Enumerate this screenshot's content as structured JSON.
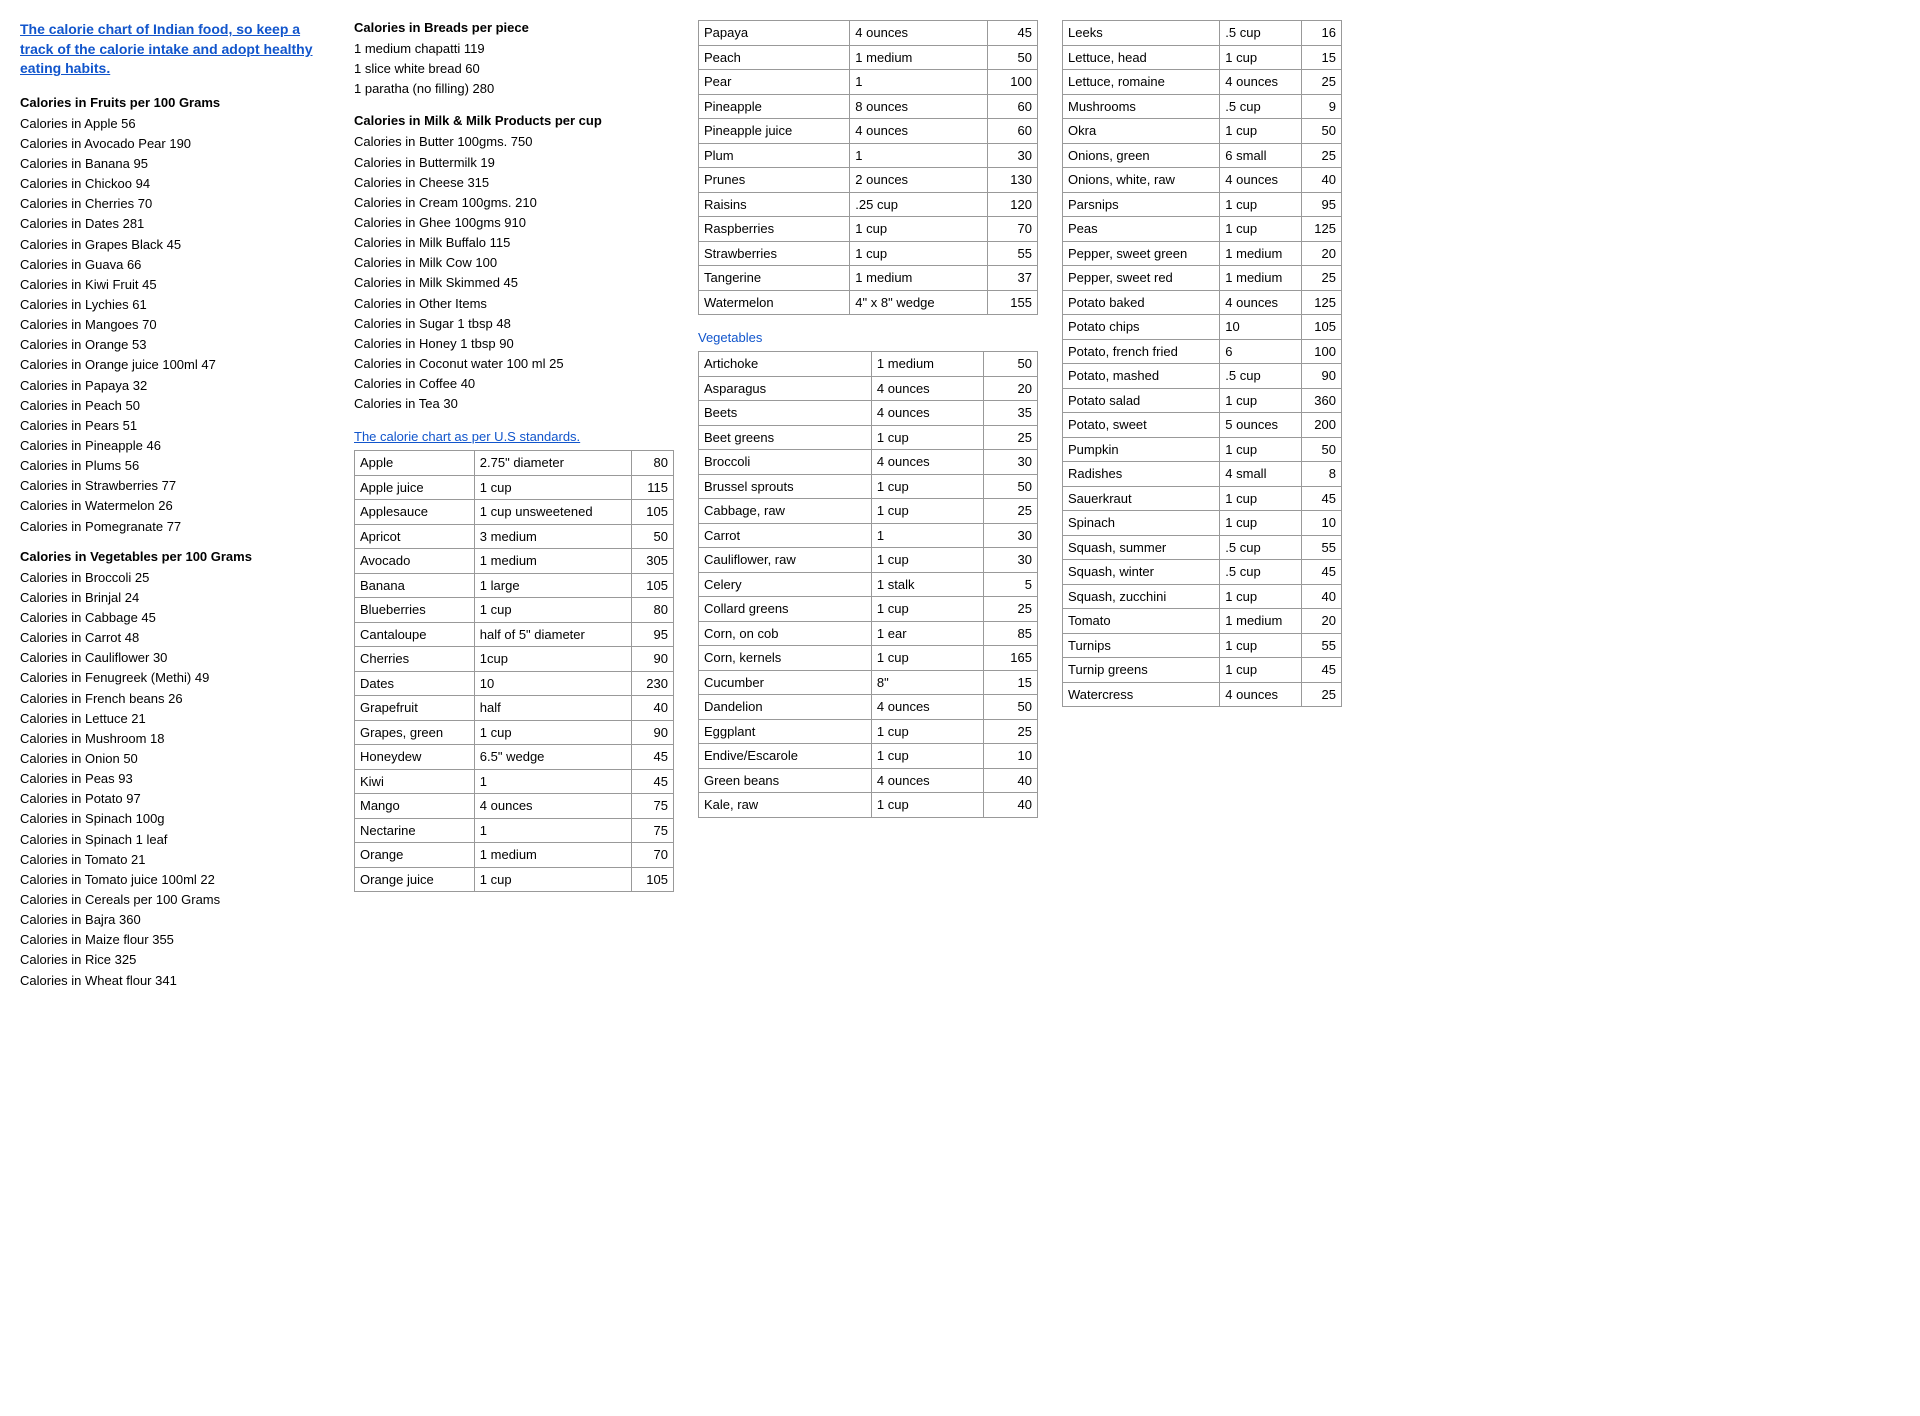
{
  "title": {
    "text": "The calorie chart of Indian food, so keep a track of the calorie intake and adopt healthy eating habits.",
    "link": true
  },
  "col1": {
    "fruits_section": {
      "title": "Calories in Fruits per 100 Grams",
      "items": [
        "Calories in Apple 56",
        "Calories in Avocado Pear 190",
        "Calories in Banana 95",
        "Calories in Chickoo 94",
        "Calories in Cherries 70",
        "Calories in Dates 281",
        "Calories in Grapes Black 45",
        "Calories in Guava 66",
        "Calories in Kiwi Fruit 45",
        "Calories in Lychies 61",
        "Calories in Mangoes 70",
        "Calories in Orange 53",
        "Calories in Orange juice 100ml 47",
        "Calories in Papaya 32",
        "Calories in Peach 50",
        "Calories in Pears 51",
        "Calories in Pineapple 46",
        "Calories in Plums 56",
        "Calories in Strawberries 77",
        "Calories in Watermelon 26",
        "Calories in Pomegranate 77"
      ]
    },
    "vegetables_section": {
      "title": "Calories in Vegetables per 100 Grams",
      "items": [
        "Calories in Broccoli 25",
        "Calories in Brinjal 24",
        "Calories in Cabbage 45",
        "Calories in Carrot 48",
        "Calories in Cauliflower 30",
        "Calories in Fenugreek (Methi) 49",
        "Calories in French beans 26",
        "Calories in Lettuce 21",
        "Calories in Mushroom 18",
        "Calories in Onion 50",
        "Calories in Peas 93",
        "Calories in Potato 97",
        "Calories in Spinach 100g",
        "Calories in Spinach 1 leaf",
        "Calories in Tomato 21",
        "Calories in Tomato juice 100ml 22",
        "Calories in Cereals per 100 Grams",
        "Calories in Bajra 360",
        "Calories in Maize flour 355",
        "Calories in Rice 325",
        "Calories in Wheat flour 341"
      ]
    }
  },
  "col2": {
    "breads_section": {
      "title": "Calories in Breads per piece",
      "items": [
        "1 medium chapatti 119",
        "1 slice white bread 60",
        "1 paratha (no filling) 280"
      ]
    },
    "milk_section": {
      "title": "Calories in Milk & Milk Products per cup",
      "items": [
        "Calories in Butter 100gms. 750",
        "Calories in Buttermilk 19",
        "Calories in Cheese 315",
        "Calories in Cream 100gms. 210",
        "Calories in Ghee 100gms 910",
        "Calories in Milk Buffalo 115",
        "Calories in Milk Cow 100",
        "Calories in Milk Skimmed 45",
        "Calories in Other Items",
        "Calories in Sugar 1 tbsp 48",
        "Calories in Honey 1 tbsp 90",
        "Calories in Coconut water 100 ml 25",
        "Calories in Coffee 40",
        "Calories in Tea 30"
      ]
    },
    "us_section": {
      "title": "The calorie chart as per U.S standards.",
      "fruits": [
        [
          "Apple",
          "2.75\" diameter",
          "80"
        ],
        [
          "Apple juice",
          "1 cup",
          "115"
        ],
        [
          "Applesauce",
          "1 cup unsweetened",
          "105"
        ],
        [
          "Apricot",
          "3 medium",
          "50"
        ],
        [
          "Avocado",
          "1 medium",
          "305"
        ],
        [
          "Banana",
          "1 large",
          "105"
        ],
        [
          "Blueberries",
          "1 cup",
          "80"
        ],
        [
          "Cantaloupe",
          "half of 5\" diameter",
          "95"
        ],
        [
          "Cherries",
          "1cup",
          "90"
        ],
        [
          "Dates",
          "10",
          "230"
        ],
        [
          "Grapefruit",
          "half",
          "40"
        ],
        [
          "Grapes, green",
          "1 cup",
          "90"
        ],
        [
          "Honeydew",
          "6.5\" wedge",
          "45"
        ],
        [
          "Kiwi",
          "1",
          "45"
        ],
        [
          "Mango",
          "4 ounces",
          "75"
        ],
        [
          "Nectarine",
          "1",
          "75"
        ],
        [
          "Orange",
          "1 medium",
          "70"
        ],
        [
          "Orange juice",
          "1 cup",
          "105"
        ]
      ]
    }
  },
  "col3": {
    "fruits_continued": [
      [
        "Papaya",
        "4 ounces",
        "45"
      ],
      [
        "Peach",
        "1 medium",
        "50"
      ],
      [
        "Pear",
        "1",
        "100"
      ],
      [
        "Pineapple",
        "8 ounces",
        "60"
      ],
      [
        "Pineapple juice",
        "4 ounces",
        "60"
      ],
      [
        "Plum",
        "1",
        "30"
      ],
      [
        "Prunes",
        "2 ounces",
        "130"
      ],
      [
        "Raisins",
        ".25 cup",
        "120"
      ],
      [
        "Raspberries",
        "1 cup",
        "70"
      ],
      [
        "Strawberries",
        "1 cup",
        "55"
      ],
      [
        "Tangerine",
        "1 medium",
        "37"
      ],
      [
        "Watermelon",
        "4\" x 8\" wedge",
        "155"
      ]
    ],
    "vegetables_title": "Vegetables",
    "vegetables": [
      [
        "Artichoke",
        "1 medium",
        "50"
      ],
      [
        "Asparagus",
        "4 ounces",
        "20"
      ],
      [
        "Beets",
        "4 ounces",
        "35"
      ],
      [
        "Beet greens",
        "1 cup",
        "25"
      ],
      [
        "Broccoli",
        "4 ounces",
        "30"
      ],
      [
        "Brussel sprouts",
        "1 cup",
        "50"
      ],
      [
        "Cabbage, raw",
        "1 cup",
        "25"
      ],
      [
        "Carrot",
        "1",
        "30"
      ],
      [
        "Cauliflower, raw",
        "1 cup",
        "30"
      ],
      [
        "Celery",
        "1 stalk",
        "5"
      ],
      [
        "Collard greens",
        "1 cup",
        "25"
      ],
      [
        "Corn, on cob",
        "1 ear",
        "85"
      ],
      [
        "Corn, kernels",
        "1 cup",
        "165"
      ],
      [
        "Cucumber",
        "8\"",
        "15"
      ],
      [
        "Dandelion",
        "4 ounces",
        "50"
      ],
      [
        "Eggplant",
        "1 cup",
        "25"
      ],
      [
        "Endive/Escarole",
        "1 cup",
        "10"
      ],
      [
        "Green beans",
        "4 ounces",
        "40"
      ],
      [
        "Kale, raw",
        "1 cup",
        "40"
      ]
    ]
  },
  "col4": {
    "vegetables_continued": [
      [
        "Leeks",
        ".5 cup",
        "16"
      ],
      [
        "Lettuce, head",
        "1 cup",
        "15"
      ],
      [
        "Lettuce, romaine",
        "4 ounces",
        "25"
      ],
      [
        "Mushrooms",
        ".5 cup",
        "9"
      ],
      [
        "Okra",
        "1 cup",
        "50"
      ],
      [
        "Onions, green",
        "6 small",
        "25"
      ],
      [
        "Onions, white, raw",
        "4 ounces",
        "40"
      ],
      [
        "Parsnips",
        "1 cup",
        "95"
      ],
      [
        "Peas",
        "1 cup",
        "125"
      ],
      [
        "Pepper, sweet green",
        "1 medium",
        "20"
      ],
      [
        "Pepper, sweet red",
        "1 medium",
        "25"
      ],
      [
        "Potato baked",
        "4 ounces",
        "125"
      ],
      [
        "Potato chips",
        "10",
        "105"
      ],
      [
        "Potato, french fried",
        "6",
        "100"
      ],
      [
        "Potato, mashed",
        ".5 cup",
        "90"
      ],
      [
        "Potato salad",
        "1 cup",
        "360"
      ],
      [
        "Potato, sweet",
        "5 ounces",
        "200"
      ],
      [
        "Pumpkin",
        "1 cup",
        "50"
      ],
      [
        "Radishes",
        "4 small",
        "8"
      ],
      [
        "Sauerkraut",
        "1 cup",
        "45"
      ],
      [
        "Spinach",
        "1 cup",
        "10"
      ],
      [
        "Squash, summer",
        ".5 cup",
        "55"
      ],
      [
        "Squash, winter",
        ".5 cup",
        "45"
      ],
      [
        "Squash, zucchini",
        "1 cup",
        "40"
      ],
      [
        "Tomato",
        "1 medium",
        "20"
      ],
      [
        "Turnips",
        "1 cup",
        "55"
      ],
      [
        "Turnip greens",
        "1 cup",
        "45"
      ],
      [
        "Watercress",
        "4 ounces",
        "25"
      ]
    ]
  }
}
